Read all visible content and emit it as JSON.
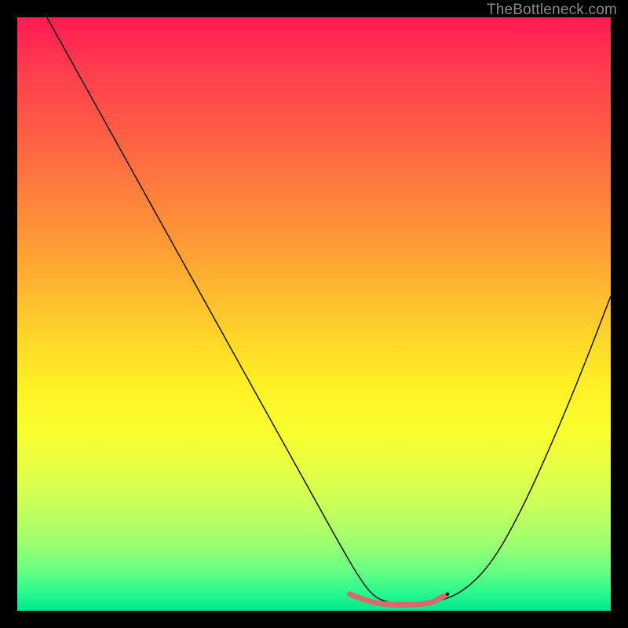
{
  "watermark": "TheBottleneck.com",
  "chart_data": {
    "type": "line",
    "title": "",
    "xlabel": "",
    "ylabel": "",
    "xlim": [
      0,
      100
    ],
    "ylim": [
      0,
      100
    ],
    "grid": false,
    "legend": false,
    "background_gradient": {
      "direction": "vertical",
      "stops": [
        {
          "pos": 0.0,
          "color": "#ff1a52"
        },
        {
          "pos": 0.5,
          "color": "#ffd629"
        },
        {
          "pos": 0.75,
          "color": "#f9ff2e"
        },
        {
          "pos": 1.0,
          "color": "#00e88f"
        }
      ]
    },
    "series": [
      {
        "name": "curve",
        "stroke": "#000000",
        "stroke_width": 1.4,
        "x": [
          5,
          10,
          15,
          20,
          25,
          30,
          35,
          40,
          45,
          50,
          55,
          58,
          60,
          62,
          65,
          68,
          70,
          75,
          80,
          85,
          90,
          95,
          100
        ],
        "y": [
          100,
          91,
          82,
          73,
          64,
          55,
          46,
          37,
          28,
          19,
          10,
          5,
          2.5,
          1.5,
          1,
          1,
          1.3,
          3,
          8,
          17,
          28,
          40,
          53
        ]
      },
      {
        "name": "bottom-highlight",
        "stroke": "#d66b6b",
        "stroke_width": 7,
        "x": [
          56,
          58,
          60,
          62,
          64,
          66,
          68,
          70,
          71,
          72
        ],
        "y": [
          2.8,
          2.0,
          1.4,
          1.1,
          1.0,
          1.0,
          1.1,
          1.4,
          2.0,
          2.5
        ]
      }
    ],
    "markers": [
      {
        "name": "dot",
        "x": 72.5,
        "y": 2.8,
        "r": 1.5,
        "color": "#000000"
      }
    ]
  }
}
